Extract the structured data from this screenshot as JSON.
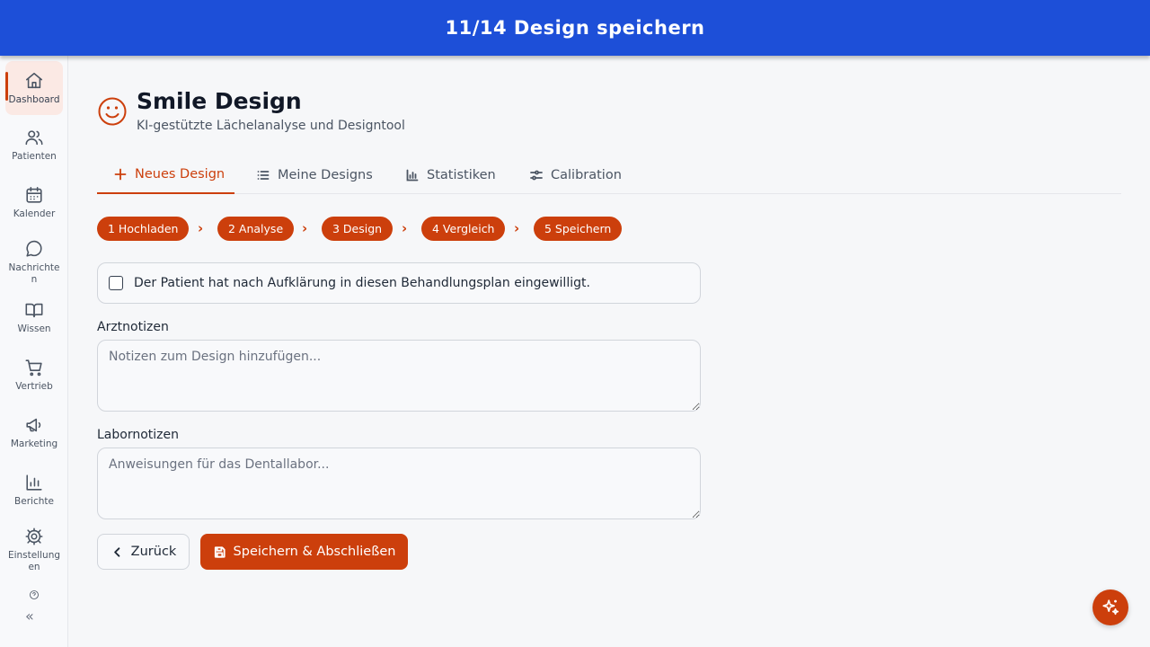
{
  "banner": {
    "title": "11/14 Design speichern"
  },
  "sidebar": {
    "items": [
      {
        "label": "Dashboard",
        "icon": "home-icon"
      },
      {
        "label": "Patienten",
        "icon": "users-icon"
      },
      {
        "label": "Kalender",
        "icon": "calendar-icon"
      },
      {
        "label": "Nachrichten",
        "icon": "message-icon"
      },
      {
        "label": "Wissen",
        "icon": "book-icon"
      },
      {
        "label": "Vertrieb",
        "icon": "cart-icon"
      },
      {
        "label": "Marketing",
        "icon": "megaphone-icon"
      },
      {
        "label": "Berichte",
        "icon": "bar-chart-icon"
      },
      {
        "label": "Einstellungen",
        "icon": "gear-icon"
      }
    ],
    "collapse_label": "«"
  },
  "header": {
    "title": "Smile Design",
    "subtitle": "KI-gestützte Lächelanalyse und Designtool",
    "icon": "smile-icon"
  },
  "tabs": [
    {
      "label": "Neues Design",
      "icon": "plus-icon",
      "active": true
    },
    {
      "label": "Meine Designs",
      "icon": "list-icon"
    },
    {
      "label": "Statistiken",
      "icon": "bar-chart-icon"
    },
    {
      "label": "Calibration",
      "icon": "sliders-icon"
    }
  ],
  "steps": [
    {
      "label": "1 Hochladen"
    },
    {
      "label": "2 Analyse"
    },
    {
      "label": "3 Design"
    },
    {
      "label": "4 Vergleich"
    },
    {
      "label": "5 Speichern"
    }
  ],
  "form": {
    "consent_text": "Der Patient hat nach Aufklärung in diesen Behandlungsplan eingewilligt.",
    "consent_checked": false,
    "doctor_notes_label": "Arztnotizen",
    "doctor_notes_placeholder": "Notizen zum Design hinzufügen...",
    "lab_notes_label": "Labornotizen",
    "lab_notes_placeholder": "Anweisungen für das Dentallabor..."
  },
  "actions": {
    "back_label": "Zurück",
    "save_label": "Speichern & Abschließen"
  },
  "colors": {
    "accent": "#cc3f0c",
    "banner": "#1d4fd8"
  }
}
